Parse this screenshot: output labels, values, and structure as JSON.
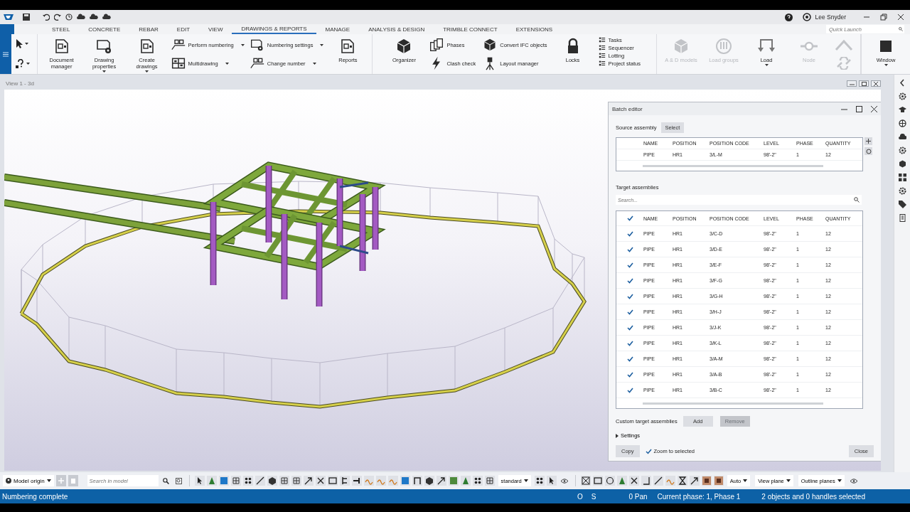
{
  "title_bar": {
    "user": "Lee Snyder"
  },
  "ribbon_tabs": [
    {
      "label": "STEEL",
      "selected": false
    },
    {
      "label": "CONCRETE",
      "selected": false
    },
    {
      "label": "REBAR",
      "selected": false
    },
    {
      "label": "EDIT",
      "selected": false
    },
    {
      "label": "VIEW",
      "selected": false
    },
    {
      "label": "DRAWINGS & REPORTS",
      "selected": true
    },
    {
      "label": "MANAGE",
      "selected": false
    },
    {
      "label": "ANALYSIS & DESIGN",
      "selected": false
    },
    {
      "label": "TRIMBLE CONNECT",
      "selected": false
    },
    {
      "label": "EXTENSIONS",
      "selected": false
    }
  ],
  "quick_launch": {
    "placeholder": "Quick Launch"
  },
  "ribbon_groups": [
    {
      "columns": [
        {
          "kind": "large",
          "items": [
            {
              "label": "Document manager",
              "disabled": false
            }
          ]
        },
        {
          "kind": "large",
          "items": [
            {
              "label": "Drawing properties",
              "disabled": false,
              "dropdown": true
            }
          ]
        },
        {
          "kind": "large",
          "items": [
            {
              "label": "Create drawings",
              "disabled": false,
              "dropdown": true
            }
          ]
        },
        {
          "kind": "stack",
          "items": [
            {
              "label": "Perform numbering",
              "disabled": false,
              "dropdown": true
            },
            {
              "label": "Multidrawing",
              "disabled": false,
              "dropdown": true
            }
          ]
        },
        {
          "kind": "stack",
          "items": [
            {
              "label": "Numbering settings",
              "disabled": false,
              "dropdown": true
            },
            {
              "label": "Change number",
              "disabled": false,
              "dropdown": true
            }
          ]
        },
        {
          "kind": "large",
          "items": [
            {
              "label": "Reports",
              "disabled": false
            }
          ]
        }
      ]
    },
    {
      "columns": [
        {
          "kind": "large",
          "items": [
            {
              "label": "Organizer",
              "disabled": false
            }
          ]
        },
        {
          "kind": "stack",
          "items": [
            {
              "label": "Phases",
              "disabled": false
            },
            {
              "label": "Clash check",
              "disabled": false
            }
          ]
        },
        {
          "kind": "stack",
          "items": [
            {
              "label": "Convert IFC objects",
              "disabled": false
            },
            {
              "label": "Layout manager",
              "disabled": false
            }
          ]
        },
        {
          "kind": "large",
          "items": [
            {
              "label": "Locks",
              "disabled": false
            }
          ]
        },
        {
          "kind": "small",
          "items": [
            {
              "label": "Tasks",
              "disabled": false
            },
            {
              "label": "Sequencer",
              "disabled": false
            },
            {
              "label": "Lotting",
              "disabled": false
            },
            {
              "label": "Project status",
              "disabled": false
            }
          ]
        }
      ]
    },
    {
      "columns": [
        {
          "kind": "large",
          "items": [
            {
              "label": "A & D models",
              "disabled": true
            }
          ]
        },
        {
          "kind": "large",
          "items": [
            {
              "label": "Load groups",
              "disabled": true
            }
          ]
        },
        {
          "kind": "large",
          "items": [
            {
              "label": "Load",
              "disabled": false,
              "dropdown": true
            }
          ]
        },
        {
          "kind": "large",
          "items": [
            {
              "label": "Node",
              "disabled": true
            }
          ]
        },
        {
          "kind": "icons",
          "disabled": true
        }
      ]
    },
    {
      "columns": [
        {
          "kind": "large",
          "items": [
            {
              "label": "Window",
              "disabled": false,
              "dropdown": true
            }
          ]
        }
      ]
    }
  ],
  "view": {
    "title": "View 1 - 3d"
  },
  "batch_editor": {
    "title": "Batch editor",
    "source_label": "Source assembly",
    "select_button": "Select",
    "source_columns": [
      "NAME",
      "POSITION",
      "POSITION CODE",
      "LEVEL",
      "PHASE",
      "QUANTITY"
    ],
    "source_rows": [
      {
        "cells": [
          "PIPE",
          "HR1",
          "3/L-M",
          "98'-2\"",
          "1",
          "12"
        ]
      }
    ],
    "target_label": "Target assemblies",
    "search": {
      "placeholder": "Search..."
    },
    "all_checked": true,
    "target_columns": [
      "NAME",
      "POSITION",
      "POSITION CODE",
      "LEVEL",
      "PHASE",
      "QUANTITY"
    ],
    "target_rows": [
      {
        "checked": true,
        "cells": [
          "PIPE",
          "HR1",
          "3/C-D",
          "98'-2\"",
          "1",
          "12"
        ]
      },
      {
        "checked": true,
        "cells": [
          "PIPE",
          "HR1",
          "3/D-E",
          "98'-2\"",
          "1",
          "12"
        ]
      },
      {
        "checked": true,
        "cells": [
          "PIPE",
          "HR1",
          "3/E-F",
          "98'-2\"",
          "1",
          "12"
        ]
      },
      {
        "checked": true,
        "cells": [
          "PIPE",
          "HR1",
          "3/F-G",
          "98'-2\"",
          "1",
          "12"
        ]
      },
      {
        "checked": true,
        "cells": [
          "PIPE",
          "HR1",
          "3/G-H",
          "98'-2\"",
          "1",
          "12"
        ]
      },
      {
        "checked": true,
        "cells": [
          "PIPE",
          "HR1",
          "3/H-J",
          "98'-2\"",
          "1",
          "12"
        ]
      },
      {
        "checked": true,
        "cells": [
          "PIPE",
          "HR1",
          "3/J-K",
          "98'-2\"",
          "1",
          "12"
        ]
      },
      {
        "checked": true,
        "cells": [
          "PIPE",
          "HR1",
          "3/K-L",
          "98'-2\"",
          "1",
          "12"
        ]
      },
      {
        "checked": true,
        "cells": [
          "PIPE",
          "HR1",
          "3/A-M",
          "98'-2\"",
          "1",
          "12"
        ]
      },
      {
        "checked": true,
        "cells": [
          "PIPE",
          "HR1",
          "3/A-B",
          "98'-2\"",
          "1",
          "12"
        ]
      },
      {
        "checked": true,
        "cells": [
          "PIPE",
          "HR1",
          "3/B-C",
          "98'-2\"",
          "1",
          "12"
        ]
      }
    ],
    "custom_label": "Custom target assemblies",
    "add_button": "Add",
    "remove_button": {
      "label": "Remove",
      "disabled": true
    },
    "settings": {
      "label": "Settings",
      "expanded": false
    },
    "copy_button": "Copy",
    "zoom_to_selected": {
      "label": "Zoom to selected",
      "checked": true
    },
    "close_button": "Close"
  },
  "bottom_toolbar": {
    "origin": "Model origin",
    "search": {
      "placeholder": "Search in model"
    },
    "representation": "standard",
    "auto": "Auto",
    "view_plane": "View plane",
    "outline_planes": "Outline planes"
  },
  "status_bar": {
    "message": "Numbering complete",
    "items": [
      "O",
      "S",
      "0 Pan",
      "Current phase: 1, Phase 1",
      "2 objects and 0 handles selected"
    ]
  }
}
